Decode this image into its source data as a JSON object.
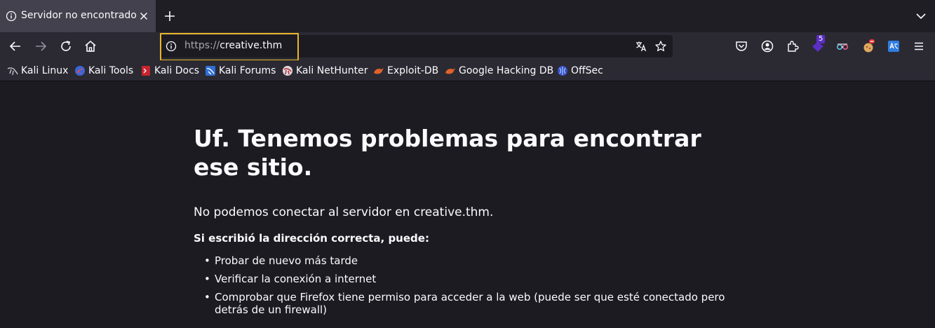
{
  "tab": {
    "title": "Servidor no encontrado"
  },
  "urlbar": {
    "scheme": "https://",
    "host": "creative.thm"
  },
  "toolbar": {
    "extension_badge": "5"
  },
  "bookmarks": [
    {
      "label": "Kali Linux",
      "icon": "kali-dragon-icon"
    },
    {
      "label": "Kali Tools",
      "icon": "kali-tools-icon"
    },
    {
      "label": "Kali Docs",
      "icon": "kali-docs-icon"
    },
    {
      "label": "Kali Forums",
      "icon": "kali-forums-icon"
    },
    {
      "label": "Kali NetHunter",
      "icon": "nethunter-icon"
    },
    {
      "label": "Exploit-DB",
      "icon": "exploit-db-icon"
    },
    {
      "label": "Google Hacking DB",
      "icon": "ghdb-icon"
    },
    {
      "label": "OffSec",
      "icon": "offsec-icon"
    }
  ],
  "error": {
    "title": "Uf. Tenemos problemas para encontrar ese sitio.",
    "description": "No podemos conectar al servidor en creative.thm.",
    "subheading": "Si escribió la dirección correcta, puede:",
    "suggestions": [
      "Probar de nuevo más tarde",
      "Verificar la conexión a internet",
      "Comprobar que Firefox tiene permiso para acceder a la web (puede ser que esté conectado pero detrás de un firewall)"
    ]
  },
  "colors": {
    "background": "#1c1b22",
    "toolbar": "#2b2a33",
    "highlight": "#e9b528"
  }
}
